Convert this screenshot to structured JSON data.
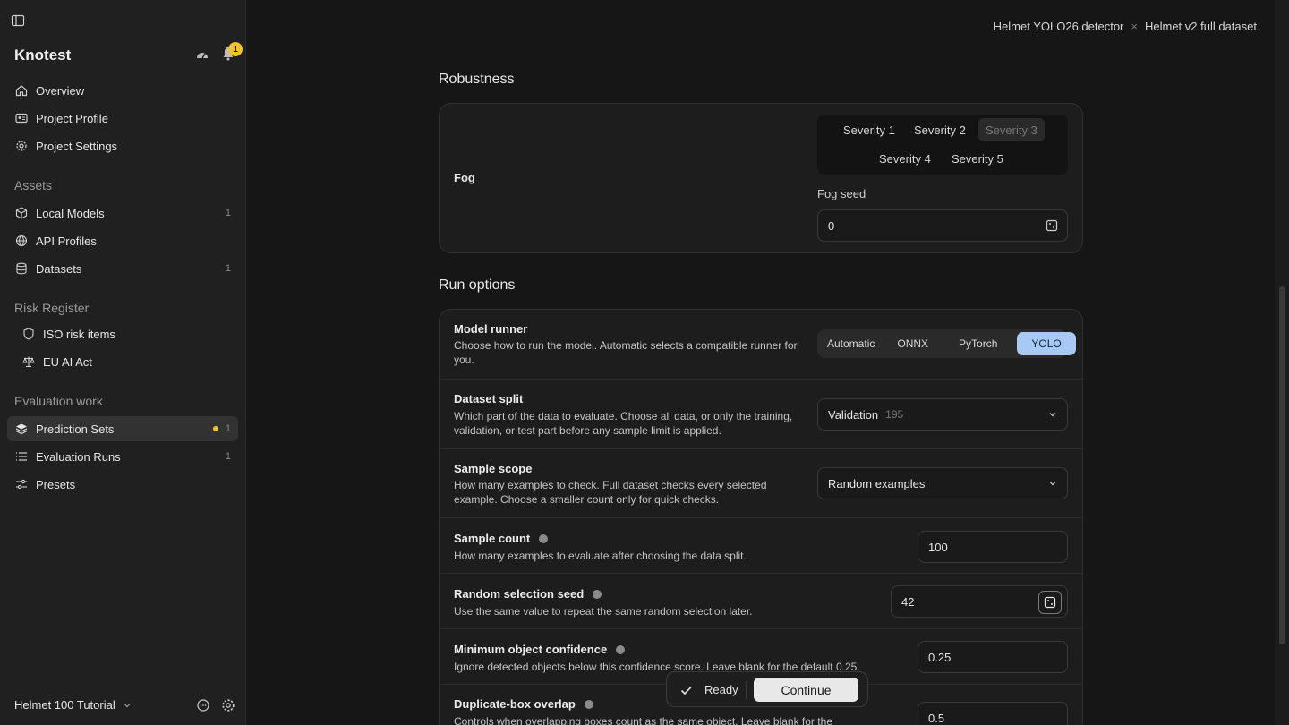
{
  "sidebar": {
    "brand": "Knotest",
    "notification_count": "1",
    "nav_top": [
      {
        "label": "Overview",
        "icon": "home-icon"
      },
      {
        "label": "Project Profile",
        "icon": "id-card-icon"
      },
      {
        "label": "Project Settings",
        "icon": "gear-icon"
      }
    ],
    "assets_label": "Assets",
    "assets": [
      {
        "label": "Local Models",
        "count": "1",
        "icon": "cube-icon"
      },
      {
        "label": "API Profiles",
        "count": "",
        "icon": "globe-icon"
      },
      {
        "label": "Datasets",
        "count": "1",
        "icon": "database-icon"
      }
    ],
    "risk_label": "Risk Register",
    "risk": [
      {
        "label": "ISO risk items",
        "icon": "shield-icon"
      },
      {
        "label": "EU AI Act",
        "icon": "scale-icon"
      }
    ],
    "eval_label": "Evaluation work",
    "eval": [
      {
        "label": "Prediction Sets",
        "count": "1",
        "icon": "layers-icon"
      },
      {
        "label": "Evaluation Runs",
        "count": "1",
        "icon": "list-icon"
      },
      {
        "label": "Presets",
        "count": "",
        "icon": "sliders-icon"
      }
    ],
    "project_name": "Helmet 100 Tutorial"
  },
  "breadcrumb": {
    "model": "Helmet YOLO26 detector",
    "separator": "×",
    "dataset": "Helmet v2 full dataset"
  },
  "robustness": {
    "heading": "Robustness",
    "fog_label": "Fog",
    "severities": [
      "Severity 1",
      "Severity 2",
      "Severity 3",
      "Severity 4",
      "Severity 5"
    ],
    "selected_severity": "Severity 3",
    "seed_label": "Fog seed",
    "seed_value": "0"
  },
  "run_options": {
    "heading": "Run options",
    "model_runner": {
      "title": "Model runner",
      "desc": "Choose how to run the model. Automatic selects a compatible runner for you.",
      "options": [
        "Automatic",
        "ONNX",
        "PyTorch",
        "YOLO"
      ],
      "selected": "YOLO"
    },
    "dataset_split": {
      "title": "Dataset split",
      "desc": "Which part of the data to evaluate. Choose all data, or only the training, validation, or test part before any sample limit is applied.",
      "value": "Validation",
      "count": "195"
    },
    "sample_scope": {
      "title": "Sample scope",
      "desc": "How many examples to check. Full dataset checks every selected example. Choose a smaller count only for quick checks.",
      "value": "Random examples"
    },
    "sample_count": {
      "title": "Sample count",
      "desc": "How many examples to evaluate after choosing the data split.",
      "value": "100"
    },
    "random_seed": {
      "title": "Random selection seed",
      "desc": "Use the same value to repeat the same random selection later.",
      "value": "42"
    },
    "min_confidence": {
      "title": "Minimum object confidence",
      "desc": "Ignore detected objects below this confidence score. Leave blank for the default 0.25.",
      "value": "0.25"
    },
    "dup_overlap": {
      "title": "Duplicate-box overlap",
      "desc": "Controls when overlapping boxes count as the same object. Leave blank for the",
      "value": "0.5"
    }
  },
  "toast": {
    "status": "Ready",
    "button": "Continue"
  },
  "colors": {
    "accent": "#a9c9f5",
    "badge": "#f2c230"
  }
}
